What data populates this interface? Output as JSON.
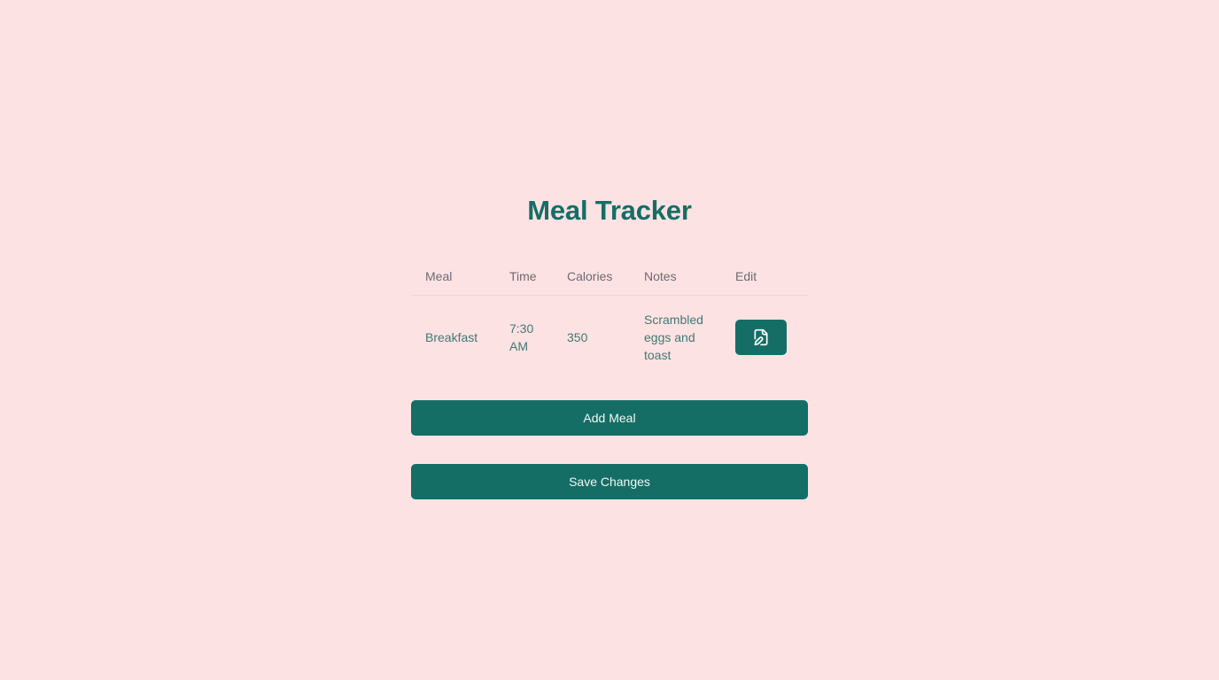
{
  "page": {
    "title": "Meal Tracker"
  },
  "table": {
    "headers": {
      "meal": "Meal",
      "time": "Time",
      "calories": "Calories",
      "notes": "Notes",
      "edit": "Edit"
    },
    "rows": [
      {
        "meal": "Breakfast",
        "time": "7:30 AM",
        "calories": "350",
        "notes": "Scrambled eggs and toast",
        "edit_icon": "file-edit-icon"
      }
    ]
  },
  "actions": {
    "add_label": "Add Meal",
    "save_label": "Save Changes"
  },
  "colors": {
    "background": "#fde2e4",
    "accent": "#146e66",
    "header_text": "#6b6b72",
    "cell_text": "#3f7a72"
  }
}
